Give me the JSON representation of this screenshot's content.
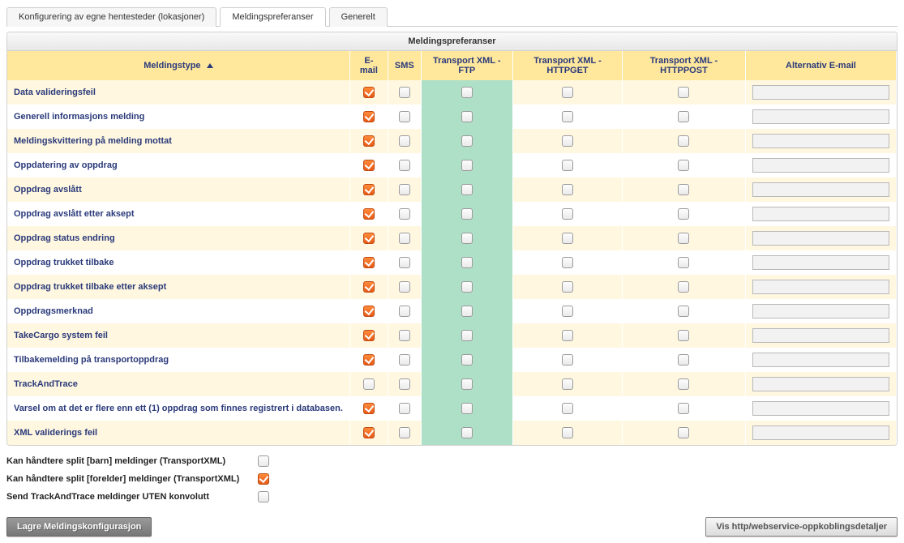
{
  "tabs": [
    {
      "label": "Konfigurering av egne hentesteder (lokasjoner)",
      "active": false
    },
    {
      "label": "Meldingspreferanser",
      "active": true
    },
    {
      "label": "Generelt",
      "active": false
    }
  ],
  "panel": {
    "title": "Meldingspreferanser"
  },
  "columns": {
    "type": "Meldingstype",
    "email": "E-mail",
    "sms": "SMS",
    "ftp": "Transport XML - FTP",
    "httpget": "Transport XML - HTTPGET",
    "httppost": "Transport XML - HTTPPOST",
    "altEmail": "Alternativ E-mail"
  },
  "rows": [
    {
      "name": "Data valideringsfeil",
      "email": true,
      "sms": false,
      "ftp": false,
      "httpget": false,
      "httppost": false,
      "altEmail": ""
    },
    {
      "name": "Generell informasjons melding",
      "email": true,
      "sms": false,
      "ftp": false,
      "httpget": false,
      "httppost": false,
      "altEmail": ""
    },
    {
      "name": "Meldingskvittering på melding mottat",
      "email": true,
      "sms": false,
      "ftp": false,
      "httpget": false,
      "httppost": false,
      "altEmail": ""
    },
    {
      "name": "Oppdatering av oppdrag",
      "email": true,
      "sms": false,
      "ftp": false,
      "httpget": false,
      "httppost": false,
      "altEmail": ""
    },
    {
      "name": "Oppdrag avslått",
      "email": true,
      "sms": false,
      "ftp": false,
      "httpget": false,
      "httppost": false,
      "altEmail": ""
    },
    {
      "name": "Oppdrag avslått etter aksept",
      "email": true,
      "sms": false,
      "ftp": false,
      "httpget": false,
      "httppost": false,
      "altEmail": ""
    },
    {
      "name": "Oppdrag status endring",
      "email": true,
      "sms": false,
      "ftp": false,
      "httpget": false,
      "httppost": false,
      "altEmail": ""
    },
    {
      "name": "Oppdrag trukket tilbake",
      "email": true,
      "sms": false,
      "ftp": false,
      "httpget": false,
      "httppost": false,
      "altEmail": ""
    },
    {
      "name": "Oppdrag trukket tilbake etter aksept",
      "email": true,
      "sms": false,
      "ftp": false,
      "httpget": false,
      "httppost": false,
      "altEmail": ""
    },
    {
      "name": "Oppdragsmerknad",
      "email": true,
      "sms": false,
      "ftp": false,
      "httpget": false,
      "httppost": false,
      "altEmail": ""
    },
    {
      "name": "TakeCargo system feil",
      "email": true,
      "sms": false,
      "ftp": false,
      "httpget": false,
      "httppost": false,
      "altEmail": ""
    },
    {
      "name": "Tilbakemelding på transportoppdrag",
      "email": true,
      "sms": false,
      "ftp": false,
      "httpget": false,
      "httppost": false,
      "altEmail": ""
    },
    {
      "name": "TrackAndTrace",
      "email": false,
      "sms": false,
      "ftp": false,
      "httpget": false,
      "httppost": false,
      "altEmail": ""
    },
    {
      "name": "Varsel om at det er flere enn ett (1) oppdrag som finnes registrert i databasen.",
      "email": true,
      "sms": false,
      "ftp": false,
      "httpget": false,
      "httppost": false,
      "altEmail": ""
    },
    {
      "name": "XML validerings feil",
      "email": true,
      "sms": false,
      "ftp": false,
      "httpget": false,
      "httppost": false,
      "altEmail": ""
    }
  ],
  "options": [
    {
      "label": "Kan håndtere split [barn] meldinger (TransportXML)",
      "checked": false
    },
    {
      "label": "Kan håndtere split [forelder] meldinger (TransportXML)",
      "checked": true
    },
    {
      "label": "Send TrackAndTrace meldinger UTEN konvolutt",
      "checked": false
    }
  ],
  "buttons": {
    "save": "Lagre Meldingskonfigurasjon",
    "details": "Vis http/webservice-oppkoblingsdetaljer"
  }
}
